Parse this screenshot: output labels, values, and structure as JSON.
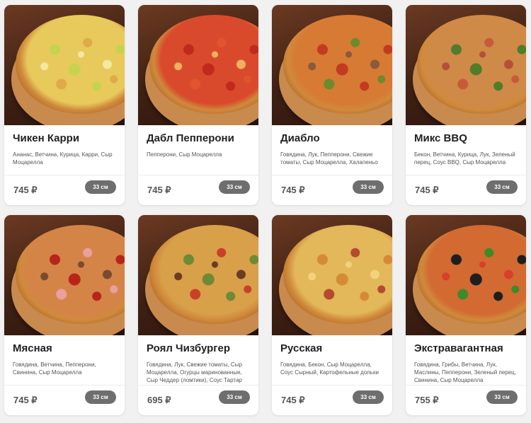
{
  "currency": "₽",
  "pizzas": [
    {
      "name": "Чикен Карри",
      "ingredients": "Ананас, Ветчина, Курица, Карри, Сыр Моцарелла",
      "price": "745 ₽",
      "size": "33 см",
      "base": "#e8c95c",
      "toppings": [
        "#c6d34e",
        "#e0a94a",
        "#f3e9a0"
      ]
    },
    {
      "name": "Дабл Пепперони",
      "ingredients": "Пепперони, Сыр Моцарелла",
      "price": "745 ₽",
      "size": "33 см",
      "base": "#d94a2c",
      "toppings": [
        "#c0291c",
        "#e0552f",
        "#f0b060"
      ]
    },
    {
      "name": "Диабло",
      "ingredients": "Говядина, Лук, Пепперони, Свежие томаты, Сыр Моцарелла, Халапеньо",
      "price": "745 ₽",
      "size": "33 см",
      "base": "#d77a34",
      "toppings": [
        "#c23a1f",
        "#6c8a2e",
        "#8a5a3a"
      ]
    },
    {
      "name": "Микс BBQ",
      "ingredients": "Бекон, Ветчина, Курица, Лук, Зеленый перец, Соус BBQ, Сыр Моцарелла",
      "price": "745 ₽",
      "size": "33 см",
      "base": "#cf8a48",
      "toppings": [
        "#4f7d2a",
        "#c85a3c",
        "#b4503a"
      ]
    },
    {
      "name": "Мясная",
      "ingredients": "Говядина, Ветчина, Пепперони, Свинина, Сыр Моцарелла",
      "price": "745 ₽",
      "size": "33 см",
      "base": "#d58448",
      "toppings": [
        "#b8241a",
        "#e8a0a0",
        "#7a4a30"
      ]
    },
    {
      "name": "Роял Чизбургер",
      "ingredients": "Говядина, Лук, Свежие томаты, Сыр Моцарелла, Огурцы маринованные, Сыр Чеддер (ломтики), Соус Тартар",
      "price": "695 ₽",
      "size": "33 см",
      "base": "#d9a04a",
      "toppings": [
        "#6e8a34",
        "#c8402a",
        "#6b3c24"
      ]
    },
    {
      "name": "Русская",
      "ingredients": "Говядина, Бекон, Сыр Моцарелла, Соус Сырный, Картофельные дольки",
      "price": "745 ₽",
      "size": "33 см",
      "base": "#e2b85a",
      "toppings": [
        "#d68a36",
        "#b44a2e",
        "#f2d27a"
      ]
    },
    {
      "name": "Экстравагантная",
      "ingredients": "Говядина, Грибы, Ветчина, Лук, Маслины, Пепперони, Зеленый перец, Свинина, Сыр Моцарелла",
      "price": "755 ₽",
      "size": "33 см",
      "base": "#d26a32",
      "toppings": [
        "#1e1e1e",
        "#3d8a2a",
        "#d8402a"
      ]
    }
  ]
}
